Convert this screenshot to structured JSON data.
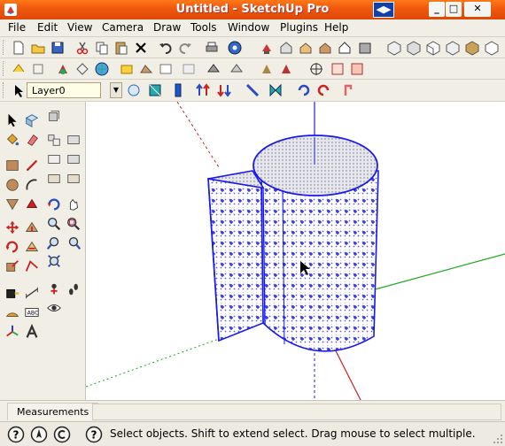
{
  "window": {
    "title": "Untitled - SketchUp Pro"
  },
  "menu": [
    "File",
    "Edit",
    "View",
    "Camera",
    "Draw",
    "Tools",
    "Window",
    "Plugins",
    "Help"
  ],
  "layer": {
    "current": "Layer0"
  },
  "measurements": {
    "label": "Measurements",
    "value": ""
  },
  "status": {
    "message": "Select objects. Shift to extend select. Drag mouse to select multiple."
  },
  "colors": {
    "titlebar": "#f05a0e",
    "model_edges": "#1a1aee",
    "axis_red": "#cc2222",
    "axis_green": "#22aa22",
    "axis_blue": "#2222cc"
  }
}
